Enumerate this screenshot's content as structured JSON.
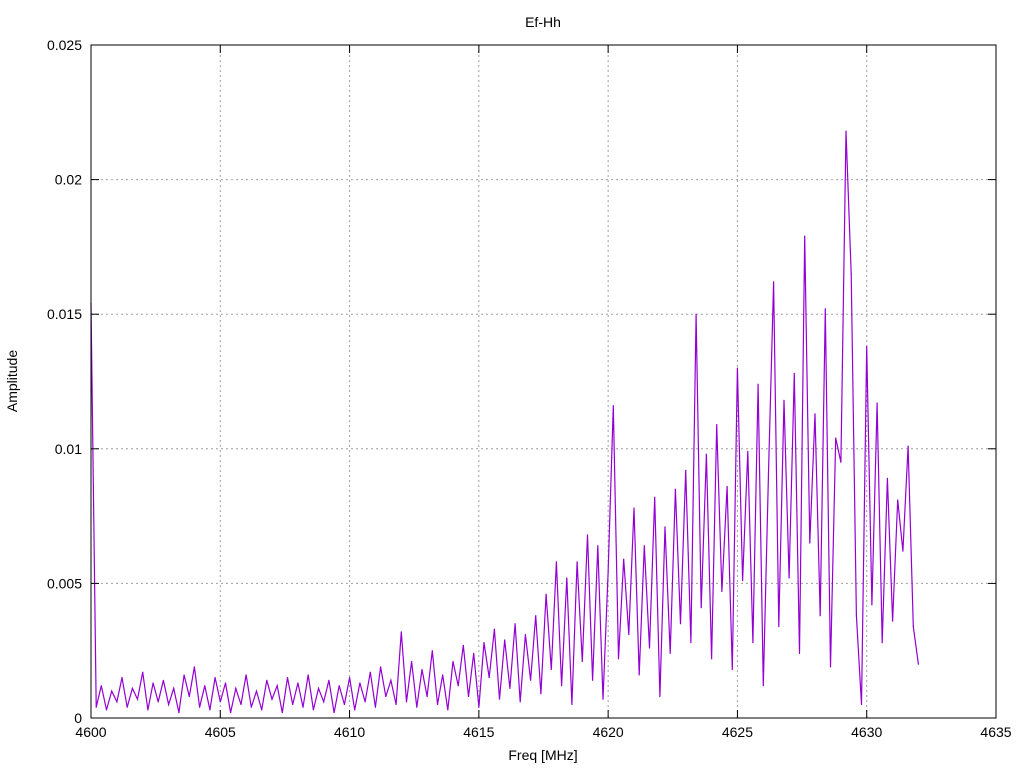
{
  "chart_data": {
    "type": "line",
    "title": "Ef-Hh",
    "xlabel": "Freq [MHz]",
    "ylabel": "Amplitude",
    "xlim": [
      4600,
      4635
    ],
    "ylim": [
      0,
      0.025
    ],
    "xticks": [
      "4600",
      "4605",
      "4610",
      "4615",
      "4620",
      "4625",
      "4630",
      "4635"
    ],
    "yticks": [
      "0",
      "0.005",
      "0.01",
      "0.015",
      "0.02",
      "0.025"
    ],
    "grid": true,
    "series": [
      {
        "name": "Ef-Hh",
        "color": "#9400d3",
        "x_start": 4600,
        "x_step": 0.2,
        "values": [
          0.0154,
          0.0004,
          0.0012,
          0.0003,
          0.001,
          0.0006,
          0.0015,
          0.0004,
          0.0011,
          0.0007,
          0.0017,
          0.0003,
          0.0013,
          0.0006,
          0.0014,
          0.0005,
          0.0011,
          0.0002,
          0.0016,
          0.0008,
          0.0019,
          0.0004,
          0.0012,
          0.0003,
          0.0015,
          0.0006,
          0.0013,
          0.0002,
          0.0011,
          0.0005,
          0.0016,
          0.0004,
          0.001,
          0.0003,
          0.0014,
          0.0007,
          0.0012,
          0.0002,
          0.0015,
          0.0005,
          0.0013,
          0.0004,
          0.0016,
          0.0003,
          0.0011,
          0.0006,
          0.0014,
          0.0002,
          0.0012,
          0.0005,
          0.0015,
          0.0003,
          0.0013,
          0.0006,
          0.0017,
          0.0004,
          0.0019,
          0.0008,
          0.0014,
          0.0005,
          0.0032,
          0.0006,
          0.0021,
          0.0004,
          0.0018,
          0.0008,
          0.0025,
          0.0005,
          0.0016,
          0.0003,
          0.0021,
          0.0012,
          0.0027,
          0.0008,
          0.0024,
          0.0004,
          0.0028,
          0.0015,
          0.0033,
          0.0007,
          0.0029,
          0.0011,
          0.0035,
          0.0006,
          0.0031,
          0.0014,
          0.0038,
          0.0009,
          0.0046,
          0.0018,
          0.0058,
          0.0012,
          0.0052,
          0.0005,
          0.0058,
          0.0021,
          0.0068,
          0.0014,
          0.0064,
          0.0007,
          0.0054,
          0.0116,
          0.0022,
          0.0059,
          0.0031,
          0.0078,
          0.0016,
          0.0064,
          0.0026,
          0.0082,
          0.0008,
          0.0071,
          0.0024,
          0.0085,
          0.0035,
          0.0092,
          0.0028,
          0.015,
          0.0041,
          0.0098,
          0.0022,
          0.0109,
          0.0047,
          0.0086,
          0.0018,
          0.013,
          0.0051,
          0.0099,
          0.0028,
          0.0124,
          0.0012,
          0.0091,
          0.0162,
          0.0034,
          0.0118,
          0.0052,
          0.0128,
          0.0024,
          0.0179,
          0.0065,
          0.0113,
          0.0038,
          0.0152,
          0.0019,
          0.0104,
          0.0095,
          0.0218,
          0.0165,
          0.0038,
          0.0005,
          0.0138,
          0.0042,
          0.0117,
          0.0028,
          0.0089,
          0.0036,
          0.0081,
          0.0062,
          0.0101,
          0.0034,
          0.002
        ]
      }
    ]
  }
}
